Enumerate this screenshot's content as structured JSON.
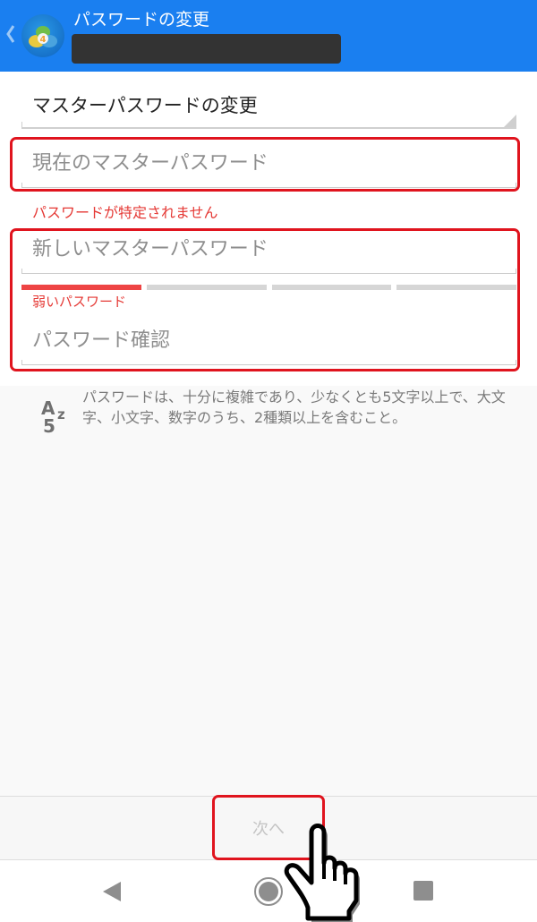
{
  "header": {
    "title": "パスワードの変更",
    "subtitle_redacted": true,
    "back_icon": "chevron-left-icon",
    "logo_icon": "metatrader-4-logo",
    "background_color": "#1a7ff0"
  },
  "form": {
    "mode_select": {
      "value": "マスターパスワードの変更"
    },
    "current_password": {
      "placeholder": "現在のマスターパスワード",
      "value": "",
      "error": "パスワードが特定されません"
    },
    "new_password": {
      "placeholder": "新しいマスターパスワード",
      "value": "",
      "strength_label": "弱いパスワード",
      "strength_level": 1,
      "strength_max": 4
    },
    "confirm_password": {
      "placeholder": "パスワード確認",
      "value": ""
    },
    "error_color": "#e53935",
    "highlight_color": "#e0141e"
  },
  "hint": {
    "icon": "az5-password-rule-icon",
    "icon_glyphs": {
      "a": "A",
      "z": "z",
      "five": "5"
    },
    "text": "パスワードは、十分に複雑であり、少なくとも5文字以上で、大文字、小文字、数字のうち、2種類以上を含むこと。"
  },
  "footer": {
    "next_label": "次へ",
    "next_enabled": false
  },
  "system_nav": {
    "back": "back-triangle-icon",
    "home": "home-circle-icon",
    "recents": "recents-square-icon"
  },
  "annotation": {
    "pointer": "pointing-hand-icon"
  }
}
